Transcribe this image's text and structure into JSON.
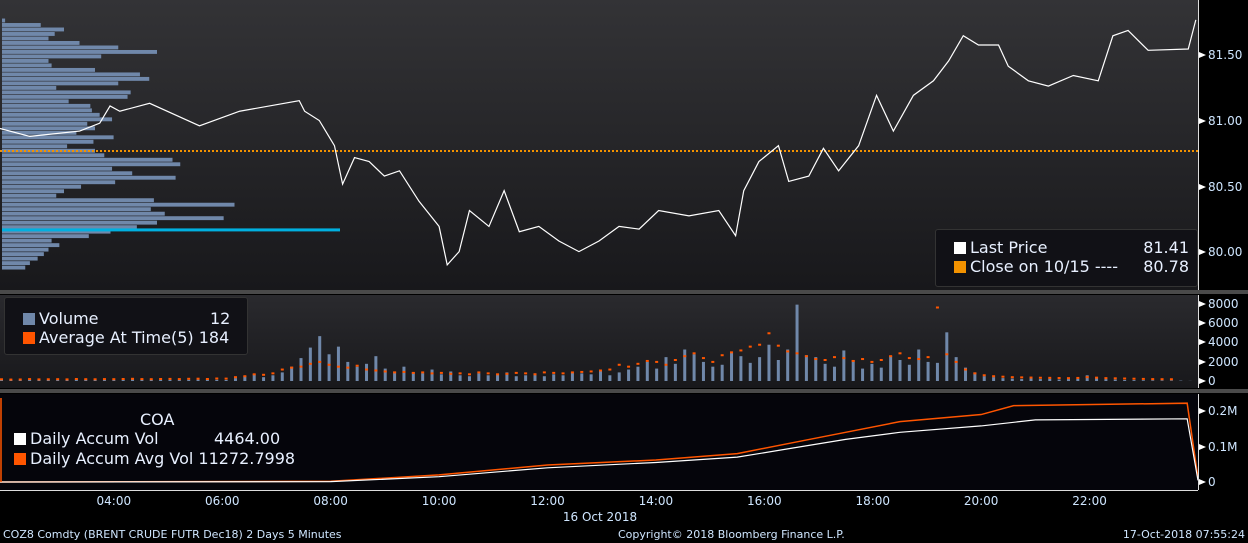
{
  "main": {
    "legend": {
      "last_price_label": "Last Price",
      "last_price_value": "81.41",
      "close_label": "Close on 10/15 ----",
      "close_value": "80.78"
    },
    "y_ticks": [
      "81.50",
      "81.00",
      "80.50",
      "80.00"
    ]
  },
  "volume": {
    "legend": {
      "volume_label": "Volume",
      "volume_value": "12",
      "avg_label": "Average At Time(5)",
      "avg_value": "184"
    },
    "y_ticks": [
      "8000",
      "6000",
      "4000",
      "2000",
      "0"
    ]
  },
  "coa": {
    "title": "COA",
    "legend": {
      "accum_label": "Daily Accum Vol",
      "accum_value": "4464.00",
      "avg_label": "Daily Accum Avg Vol",
      "avg_value": "11272.7998"
    },
    "y_ticks": [
      "0.2M",
      "0.1M",
      "0"
    ]
  },
  "x_axis": {
    "ticks": [
      "04:00",
      "06:00",
      "08:00",
      "10:00",
      "12:00",
      "14:00",
      "16:00",
      "18:00",
      "20:00",
      "22:00"
    ],
    "date": "16 Oct 2018"
  },
  "footer": {
    "security": "COZ8 Comdty (BRENT CRUDE FUTR  Dec18) 2 Days 5 Minutes",
    "copyright": "Copyright© 2018 Bloomberg Finance L.P.",
    "timestamp": "17-Oct-2018 07:55:24"
  },
  "colors": {
    "price": "#ffffff",
    "close": "#f39200",
    "volume": "#7088aa",
    "avg": "#ff5500",
    "poc": "#00b0e0"
  },
  "chart_data": {
    "type": "line",
    "price": [
      [
        1.9,
        80.95
      ],
      [
        2.45,
        80.89
      ],
      [
        3.37,
        80.93
      ],
      [
        3.74,
        80.99
      ],
      [
        3.93,
        81.12
      ],
      [
        4.11,
        81.08
      ],
      [
        4.66,
        81.14
      ],
      [
        5.58,
        80.97
      ],
      [
        6.32,
        81.08
      ],
      [
        7.42,
        81.16
      ],
      [
        7.52,
        81.08
      ],
      [
        7.79,
        81.01
      ],
      [
        8.07,
        80.82
      ],
      [
        8.22,
        80.53
      ],
      [
        8.44,
        80.73
      ],
      [
        8.71,
        80.7
      ],
      [
        8.99,
        80.59
      ],
      [
        9.27,
        80.63
      ],
      [
        9.63,
        80.4
      ],
      [
        10.0,
        80.21
      ],
      [
        10.15,
        79.92
      ],
      [
        10.37,
        80.02
      ],
      [
        10.56,
        80.33
      ],
      [
        10.92,
        80.21
      ],
      [
        11.2,
        80.48
      ],
      [
        11.48,
        80.17
      ],
      [
        11.84,
        80.21
      ],
      [
        12.21,
        80.1
      ],
      [
        12.58,
        80.02
      ],
      [
        12.95,
        80.1
      ],
      [
        13.32,
        80.21
      ],
      [
        13.69,
        80.19
      ],
      [
        14.05,
        80.33
      ],
      [
        14.61,
        80.29
      ],
      [
        15.16,
        80.33
      ],
      [
        15.47,
        80.14
      ],
      [
        15.62,
        80.48
      ],
      [
        15.9,
        80.7
      ],
      [
        16.26,
        80.82
      ],
      [
        16.45,
        80.55
      ],
      [
        16.82,
        80.59
      ],
      [
        17.09,
        80.8
      ],
      [
        17.37,
        80.63
      ],
      [
        17.74,
        80.82
      ],
      [
        18.07,
        81.2
      ],
      [
        18.38,
        80.93
      ],
      [
        18.75,
        81.2
      ],
      [
        19.12,
        81.31
      ],
      [
        19.4,
        81.46
      ],
      [
        19.67,
        81.65
      ],
      [
        19.95,
        81.58
      ],
      [
        20.32,
        81.58
      ],
      [
        20.5,
        81.42
      ],
      [
        20.87,
        81.31
      ],
      [
        21.24,
        81.27
      ],
      [
        21.7,
        81.35
      ],
      [
        22.16,
        81.31
      ],
      [
        22.43,
        81.65
      ],
      [
        22.71,
        81.69
      ],
      [
        23.08,
        81.54
      ],
      [
        23.82,
        81.55
      ],
      [
        23.96,
        81.77
      ]
    ],
    "close_price": 80.78,
    "price_range": [
      79.73,
      81.92
    ],
    "poc_price": 80.18,
    "volume_profile": [
      0.02,
      0.25,
      0.4,
      0.34,
      0.3,
      0.5,
      0.75,
      1.0,
      0.64,
      0.3,
      0.32,
      0.6,
      0.89,
      0.95,
      0.75,
      0.35,
      0.83,
      0.81,
      0.43,
      0.57,
      0.58,
      0.63,
      0.71,
      0.55,
      0.6,
      0.48,
      0.72,
      0.59,
      0.42,
      0.6,
      0.66,
      1.1,
      1.15,
      0.71,
      0.84,
      1.12,
      0.73,
      0.51,
      0.4,
      0.35,
      0.98,
      1.5,
      0.96,
      1.05,
      1.43,
      1.0,
      0.87,
      0.7,
      0.56,
      0.32,
      0.37,
      0.3,
      0.27,
      0.23,
      0.18,
      0.15
    ],
    "time_range": [
      1.9,
      24.0
    ],
    "volume": [
      100,
      120,
      90,
      150,
      130,
      110,
      100,
      140,
      200,
      160,
      120,
      110,
      100,
      130,
      180,
      150,
      120,
      110,
      140,
      100,
      130,
      150,
      160,
      120,
      110,
      300,
      500,
      700,
      400,
      600,
      900,
      1500,
      2400,
      3500,
      4700,
      2800,
      3600,
      2000,
      1500,
      1800,
      2600,
      1300,
      1000,
      1500,
      900,
      800,
      1200,
      700,
      1000,
      600,
      500,
      800,
      600,
      700,
      900,
      500,
      600,
      800,
      500,
      700,
      600,
      900,
      800,
      700,
      1000,
      600,
      900,
      1200,
      1500,
      2000,
      1300,
      2500,
      1800,
      3300,
      2800,
      2000,
      1500,
      1700,
      3000,
      2600,
      1900,
      2500,
      3800,
      2200,
      3300,
      8000,
      2700,
      2500,
      1800,
      1500,
      3200,
      2200,
      1300,
      1800,
      1400,
      2600,
      2200,
      1700,
      3300,
      2000,
      1900,
      5100,
      2500,
      1400,
      900,
      500,
      400,
      300,
      250,
      200,
      300,
      200,
      250,
      150,
      200,
      250,
      600,
      400,
      200,
      150,
      100,
      90,
      80,
      70,
      60,
      50,
      40,
      12
    ],
    "avg_at_time": [
      180,
      150,
      160,
      200,
      170,
      180,
      190,
      170,
      210,
      190,
      180,
      200,
      190,
      210,
      230,
      200,
      190,
      210,
      220,
      200,
      230,
      240,
      210,
      260,
      250,
      400,
      500,
      700,
      650,
      800,
      1200,
      1400,
      1500,
      1800,
      2000,
      1700,
      1500,
      1400,
      1600,
      1200,
      1100,
      1000,
      900,
      950,
      850,
      900,
      800,
      850,
      750,
      800,
      700,
      900,
      800,
      700,
      750,
      850,
      800,
      700,
      900,
      850,
      800,
      900,
      950,
      1000,
      1100,
      1200,
      1700,
      1500,
      1800,
      2100,
      2000,
      1700,
      2200,
      2600,
      2900,
      2400,
      2000,
      2700,
      3000,
      3200,
      3600,
      3800,
      5000,
      3700,
      3100,
      2900,
      2600,
      2300,
      2200,
      2500,
      2400,
      2100,
      2300,
      2000,
      2200,
      2600,
      2900,
      2400,
      2300,
      2500,
      7700,
      2800,
      2000,
      1200,
      800,
      600,
      500,
      450,
      400,
      380,
      360,
      340,
      330,
      310,
      300,
      320,
      400,
      350,
      300,
      280,
      260,
      240,
      220,
      200,
      190,
      184
    ],
    "accum_vol": [
      [
        1.9,
        0
      ],
      [
        8.0,
        1000
      ],
      [
        10.0,
        15000
      ],
      [
        12.0,
        40000
      ],
      [
        14.0,
        55000
      ],
      [
        15.5,
        70000
      ],
      [
        16.5,
        95000
      ],
      [
        17.5,
        120000
      ],
      [
        18.5,
        140000
      ],
      [
        20.0,
        158000
      ],
      [
        21.0,
        175000
      ],
      [
        23.8,
        178000
      ],
      [
        24.0,
        4464
      ]
    ],
    "accum_avg": [
      [
        1.9,
        0
      ],
      [
        8.0,
        2000
      ],
      [
        10.0,
        20000
      ],
      [
        12.0,
        48000
      ],
      [
        14.0,
        62000
      ],
      [
        15.5,
        80000
      ],
      [
        16.5,
        110000
      ],
      [
        17.5,
        140000
      ],
      [
        18.5,
        170000
      ],
      [
        20.0,
        190000
      ],
      [
        20.6,
        215000
      ],
      [
        23.8,
        222000
      ],
      [
        24.0,
        11272.8
      ]
    ],
    "accum_range": [
      0,
      230000
    ],
    "volume_range": [
      0,
      8800
    ]
  }
}
